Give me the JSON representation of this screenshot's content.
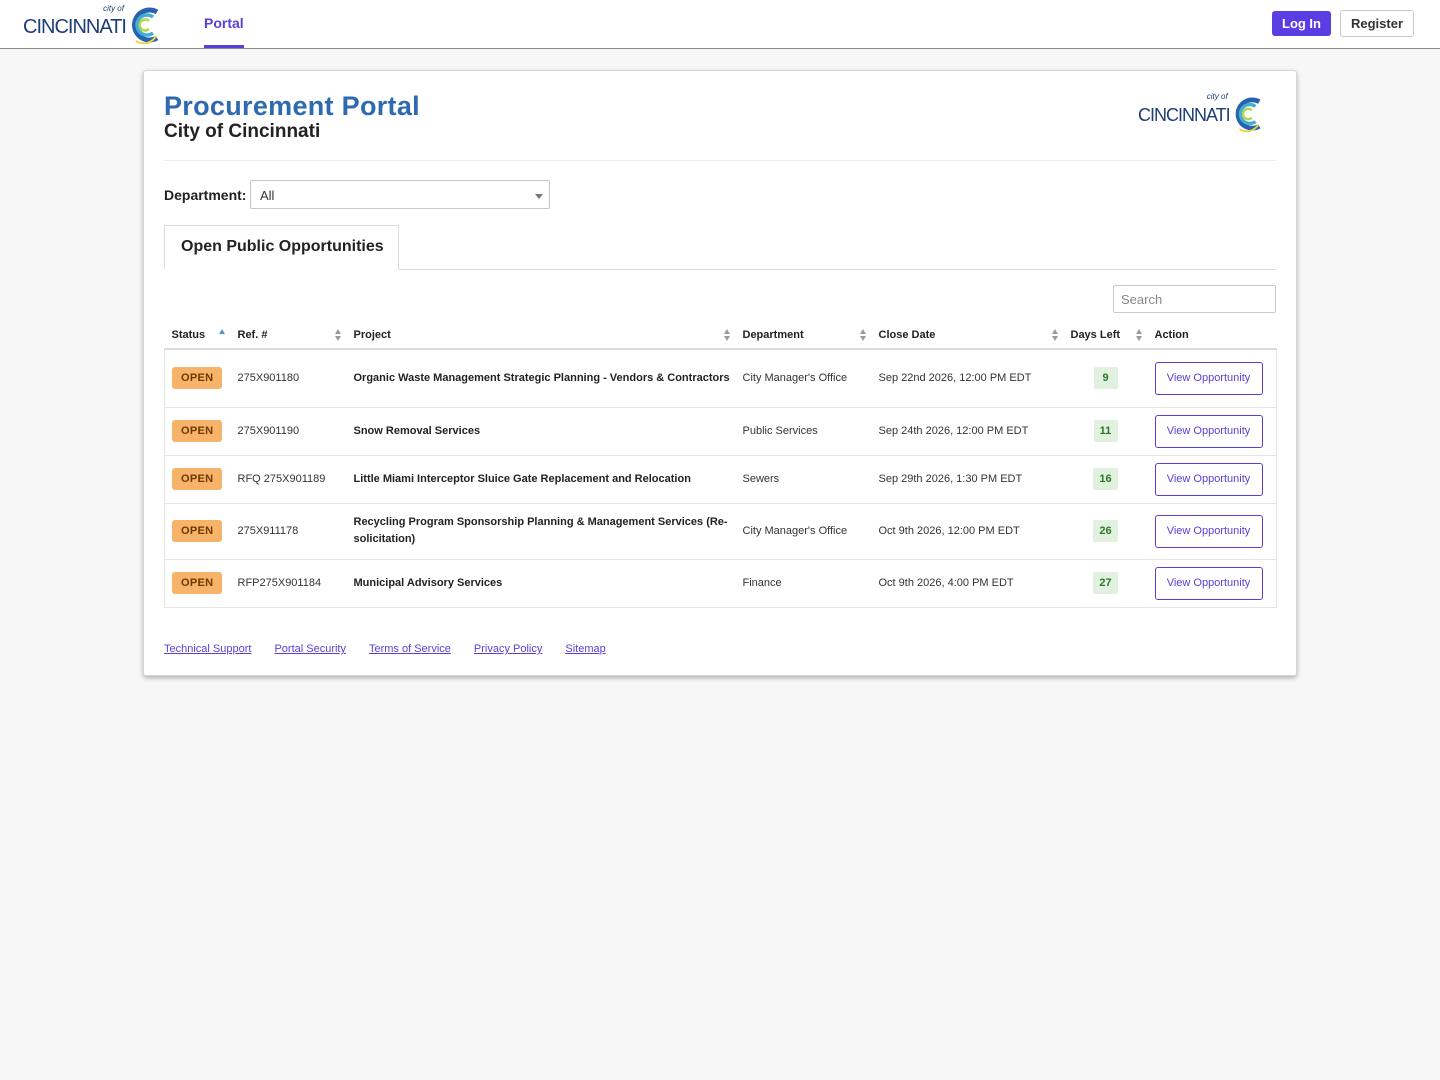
{
  "brand": {
    "city_of": "city of",
    "name": "CINCINNATI",
    "colors": {
      "navy": "#1f3e77",
      "blue": "#2e6aaf",
      "accent": "#5a3fd6"
    }
  },
  "nav": {
    "portal_label": "Portal",
    "login_label": "Log In",
    "register_label": "Register"
  },
  "header": {
    "title": "Procurement Portal",
    "subtitle": "City of Cincinnati"
  },
  "filter": {
    "department_label": "Department:",
    "department_value": "All"
  },
  "tabs": [
    {
      "label": "Open Public Opportunities",
      "active": true
    }
  ],
  "search": {
    "placeholder": "Search"
  },
  "table": {
    "columns": [
      "Status",
      "Ref. #",
      "Project",
      "Department",
      "Close Date",
      "Days Left",
      "Action"
    ],
    "sort": {
      "column": "Status",
      "direction": "asc"
    },
    "rows": [
      {
        "status": "OPEN",
        "ref": "275X901180",
        "project": "Organic Waste Management Strategic Planning - Vendors & Contractors",
        "department": "City Manager's Office",
        "close_date": "Sep 22nd 2026, 12:00 PM EDT",
        "days_left": "9",
        "action": "View Opportunity"
      },
      {
        "status": "OPEN",
        "ref": "275X901190",
        "project": "Snow Removal Services",
        "department": "Public Services",
        "close_date": "Sep 24th 2026, 12:00 PM EDT",
        "days_left": "11",
        "action": "View Opportunity"
      },
      {
        "status": "OPEN",
        "ref": "RFQ 275X901189",
        "project": "Little Miami Interceptor Sluice Gate Replacement and Relocation",
        "department": "Sewers",
        "close_date": "Sep 29th 2026, 1:30 PM EDT",
        "days_left": "16",
        "action": "View Opportunity"
      },
      {
        "status": "OPEN",
        "ref": "275X911178",
        "project": "Recycling Program Sponsorship Planning & Management Services (Re-solicitation)",
        "department": "City Manager's Office",
        "close_date": "Oct 9th 2026, 12:00 PM EDT",
        "days_left": "26",
        "action": "View Opportunity"
      },
      {
        "status": "OPEN",
        "ref": "RFP275X901184",
        "project": "Municipal Advisory Services",
        "department": "Finance",
        "close_date": "Oct 9th 2026, 4:00 PM EDT",
        "days_left": "27",
        "action": "View Opportunity"
      }
    ]
  },
  "footer": {
    "links": [
      "Technical Support",
      "Portal Security",
      "Terms of Service",
      "Privacy Policy",
      "Sitemap"
    ]
  }
}
